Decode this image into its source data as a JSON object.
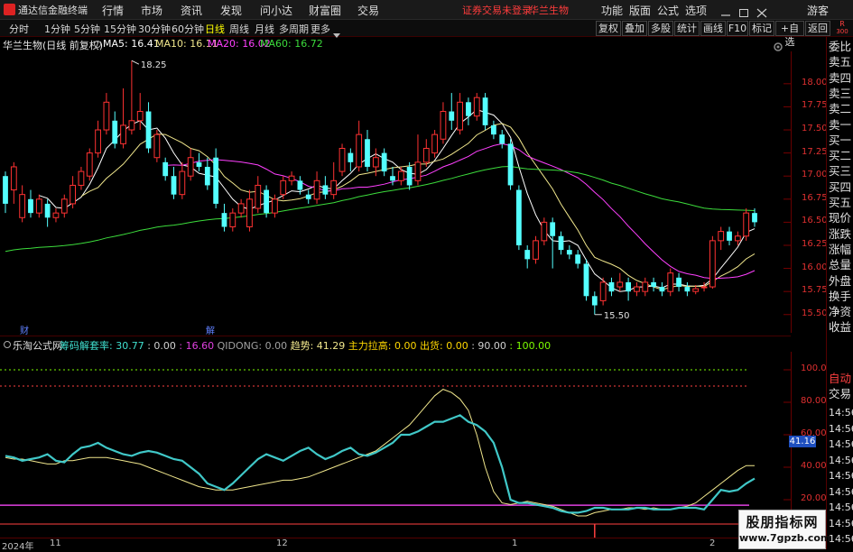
{
  "app": {
    "title": "通达信金融终端"
  },
  "menu": {
    "items": [
      "行情",
      "市场",
      "资讯",
      "发现",
      "问小达",
      "财富圈",
      "交易"
    ],
    "notice": "证券交易未登录",
    "stock": "华兰生物",
    "right_items": [
      "功能",
      "版面",
      "公式",
      "选项"
    ],
    "guest": "游客"
  },
  "toolbar": {
    "periods": [
      "分时",
      "1分钟",
      "5分钟",
      "15分钟",
      "30分钟",
      "60分钟",
      "日线",
      "周线",
      "月线",
      "多周期",
      "更多"
    ],
    "active_period": "日线",
    "buttons": [
      "复权",
      "叠加",
      "多股",
      "统计",
      "画线",
      "F10",
      "标记",
      "+自选",
      "返回"
    ],
    "corner_top": "R",
    "corner_code": "300"
  },
  "main": {
    "title": "华兰生物(日线 前复权)",
    "ma": [
      {
        "label": "MA5: 16.41",
        "color": "#ffffff"
      },
      {
        "label": "MA10: 16.11",
        "color": "#f0e68c"
      },
      {
        "label": "MA20: 16.02",
        "color": "#ff40ff"
      },
      {
        "label": "MA60: 16.72",
        "color": "#3cdc3c"
      }
    ],
    "high_label": "18.25",
    "low_label": "15.50",
    "price_ticks": [
      "18.00",
      "17.75",
      "17.50",
      "17.25",
      "17.00",
      "16.75",
      "16.50",
      "16.25",
      "16.00",
      "15.75",
      "15.50"
    ],
    "markers": [
      "财",
      "解"
    ]
  },
  "indicator": {
    "name": "乐淘公式网",
    "parts": [
      {
        "text": "筹码解套率: 30.77",
        "color": "#40e0d0"
      },
      {
        "text": ": 0.00",
        "color": "#d0d0d0"
      },
      {
        "text": ": 16.60",
        "color": "#e040e0"
      },
      {
        "text": "QIDONG: 0.00",
        "color": "#a0a0a0"
      },
      {
        "text": "趋势: 41.29",
        "color": "#f0e68c"
      },
      {
        "text": "主力拉高: 0.00",
        "color": "#ffd700"
      },
      {
        "text": "出货: 0.00",
        "color": "#ffd700"
      },
      {
        "text": ": 90.00",
        "color": "#d0d0d0"
      },
      {
        "text": ": 100.00",
        "color": "#7cfc00"
      }
    ],
    "ticks": [
      "100.00",
      "80.00",
      "60.00",
      "40.00",
      "20.00"
    ],
    "current_value": "41.16"
  },
  "date_axis": {
    "labels": [
      "2024年",
      "11",
      "12",
      "1",
      "2"
    ]
  },
  "right_panel": {
    "items": [
      "委比",
      "卖五",
      "卖四",
      "卖三",
      "卖二",
      "卖一",
      "买一",
      "买二",
      "买三",
      "买四",
      "买五",
      "现价",
      "涨跌",
      "涨幅",
      "总量",
      "外盘",
      "换手",
      "净资",
      "收益"
    ],
    "mode_items": [
      "自动",
      "交易"
    ],
    "times": [
      "14:56",
      "14:56",
      "14:56",
      "14:56",
      "14:56",
      "14:56",
      "14:56",
      "14:56",
      "14:56"
    ]
  },
  "watermark": {
    "line1": "股朋指标网",
    "line2": "www.7gpzb.com"
  },
  "chart_data": {
    "type": "candlestick",
    "y_range": [
      15.4,
      18.35
    ],
    "candles": [
      [
        17.0,
        16.7,
        17.05,
        16.6
      ],
      [
        16.85,
        17.1,
        17.15,
        16.7
      ],
      [
        16.55,
        16.8,
        16.9,
        16.5
      ],
      [
        16.75,
        16.6,
        16.85,
        16.55
      ],
      [
        16.6,
        16.75,
        16.8,
        16.55
      ],
      [
        16.7,
        16.55,
        16.75,
        16.45
      ],
      [
        16.55,
        16.6,
        16.65,
        16.5
      ],
      [
        16.6,
        16.75,
        16.8,
        16.55
      ],
      [
        16.7,
        16.9,
        17.0,
        16.65
      ],
      [
        16.9,
        17.05,
        17.1,
        16.85
      ],
      [
        17.0,
        17.25,
        17.3,
        16.95
      ],
      [
        17.25,
        17.5,
        17.6,
        17.2
      ],
      [
        17.5,
        17.8,
        17.9,
        17.45
      ],
      [
        17.6,
        17.35,
        17.7,
        17.3
      ],
      [
        17.35,
        17.55,
        17.95,
        17.3
      ],
      [
        17.5,
        17.6,
        18.25,
        17.45
      ],
      [
        17.6,
        17.7,
        17.9,
        17.5
      ],
      [
        17.7,
        17.3,
        17.8,
        17.25
      ],
      [
        17.2,
        17.45,
        17.5,
        17.15
      ],
      [
        17.15,
        17.0,
        17.2,
        16.95
      ],
      [
        17.0,
        16.8,
        17.1,
        16.75
      ],
      [
        16.8,
        17.05,
        17.15,
        16.75
      ],
      [
        17.0,
        17.2,
        17.3,
        16.95
      ],
      [
        17.15,
        17.1,
        17.25,
        17.05
      ],
      [
        17.1,
        16.9,
        17.2,
        16.85
      ],
      [
        17.2,
        16.7,
        17.3,
        16.65
      ],
      [
        16.6,
        16.45,
        16.7,
        16.4
      ],
      [
        16.45,
        16.6,
        16.65,
        16.4
      ],
      [
        16.6,
        16.7,
        16.75,
        16.55
      ],
      [
        16.45,
        16.75,
        16.85,
        16.4
      ],
      [
        16.65,
        16.9,
        17.0,
        16.6
      ],
      [
        16.85,
        16.6,
        16.9,
        16.55
      ],
      [
        16.6,
        16.75,
        16.8,
        16.55
      ],
      [
        16.8,
        16.95,
        17.0,
        16.75
      ],
      [
        16.95,
        17.0,
        17.05,
        16.9
      ],
      [
        16.95,
        16.85,
        17.0,
        16.8
      ],
      [
        16.8,
        16.75,
        16.85,
        16.7
      ],
      [
        16.75,
        16.95,
        17.05,
        16.7
      ],
      [
        16.9,
        16.8,
        17.0,
        16.75
      ],
      [
        16.8,
        16.95,
        17.15,
        16.75
      ],
      [
        17.05,
        17.3,
        17.35,
        17.0
      ],
      [
        17.25,
        17.15,
        17.3,
        17.05
      ],
      [
        17.1,
        17.45,
        17.6,
        17.05
      ],
      [
        17.4,
        17.1,
        17.5,
        17.05
      ],
      [
        17.1,
        17.2,
        17.3,
        17.0
      ],
      [
        17.25,
        17.05,
        17.3,
        17.0
      ],
      [
        17.0,
        16.95,
        17.1,
        16.9
      ],
      [
        16.95,
        17.05,
        17.1,
        16.9
      ],
      [
        17.1,
        16.9,
        17.15,
        16.85
      ],
      [
        16.95,
        17.15,
        17.45,
        16.9
      ],
      [
        17.15,
        17.3,
        17.4,
        17.1
      ],
      [
        17.25,
        17.45,
        17.5,
        17.2
      ],
      [
        17.4,
        17.7,
        17.8,
        17.35
      ],
      [
        17.7,
        17.6,
        17.9,
        17.5
      ],
      [
        17.5,
        17.8,
        17.9,
        17.45
      ],
      [
        17.8,
        17.65,
        17.85,
        17.55
      ],
      [
        17.65,
        17.85,
        17.9,
        17.6
      ],
      [
        17.85,
        17.55,
        17.9,
        17.5
      ],
      [
        17.55,
        17.45,
        17.6,
        17.4
      ],
      [
        17.45,
        17.35,
        17.5,
        17.3
      ],
      [
        17.35,
        16.9,
        17.4,
        16.85
      ],
      [
        16.85,
        16.25,
        16.9,
        16.2
      ],
      [
        16.2,
        16.1,
        16.25,
        16.0
      ],
      [
        16.1,
        16.3,
        16.35,
        16.05
      ],
      [
        16.3,
        16.5,
        16.55,
        16.25
      ],
      [
        16.5,
        16.35,
        16.55,
        16.0
      ],
      [
        16.35,
        16.2,
        16.4,
        16.15
      ],
      [
        16.2,
        16.15,
        16.25,
        16.1
      ],
      [
        16.15,
        16.05,
        16.2,
        16.0
      ],
      [
        16.05,
        15.7,
        16.1,
        15.65
      ],
      [
        15.7,
        15.6,
        15.75,
        15.5
      ],
      [
        15.65,
        15.85,
        15.9,
        15.6
      ],
      [
        15.85,
        15.75,
        15.9,
        15.7
      ],
      [
        15.8,
        15.85,
        15.95,
        15.75
      ],
      [
        15.85,
        15.75,
        15.9,
        15.65
      ],
      [
        15.75,
        15.8,
        15.85,
        15.7
      ],
      [
        15.75,
        15.85,
        15.9,
        15.7
      ],
      [
        15.85,
        15.8,
        15.9,
        15.75
      ],
      [
        15.8,
        15.75,
        15.85,
        15.7
      ],
      [
        15.75,
        15.95,
        16.0,
        15.7
      ],
      [
        15.9,
        15.8,
        15.95,
        15.75
      ],
      [
        15.8,
        15.75,
        15.85,
        15.7
      ],
      [
        15.75,
        15.78,
        15.82,
        15.72
      ],
      [
        15.8,
        15.8,
        15.85,
        15.75
      ],
      [
        15.8,
        16.3,
        16.35,
        15.78
      ],
      [
        16.3,
        16.4,
        16.45,
        16.2
      ],
      [
        16.4,
        16.3,
        16.45,
        16.25
      ],
      [
        16.3,
        16.35,
        16.4,
        16.25
      ],
      [
        16.35,
        16.6,
        16.65,
        16.3
      ],
      [
        16.6,
        16.5,
        16.65,
        16.45
      ]
    ],
    "indicator": {
      "y_range": [
        0,
        110
      ],
      "cyan": [
        47,
        46,
        44,
        45,
        46,
        48,
        44,
        43,
        48,
        52,
        53,
        55,
        52,
        50,
        48,
        47,
        49,
        50,
        49,
        47,
        45,
        44,
        40,
        36,
        30,
        28,
        26,
        30,
        35,
        40,
        45,
        48,
        46,
        44,
        47,
        50,
        52,
        48,
        45,
        47,
        50,
        52,
        48,
        47,
        49,
        52,
        55,
        60,
        60,
        62,
        65,
        68,
        68,
        70,
        72,
        68,
        66,
        62,
        55,
        40,
        20,
        18,
        18,
        17,
        16,
        15,
        13,
        12,
        12,
        13,
        15,
        15,
        14,
        14,
        14,
        15,
        15,
        14,
        14,
        14,
        15,
        15,
        15,
        14,
        20,
        26,
        25,
        26,
        30,
        33
      ],
      "yellow": [
        46,
        45,
        45,
        44,
        43,
        42,
        42,
        44,
        44,
        45,
        46,
        46,
        46,
        45,
        44,
        43,
        42,
        40,
        38,
        36,
        34,
        32,
        30,
        28,
        27,
        26,
        26,
        26,
        27,
        28,
        29,
        30,
        31,
        32,
        32,
        33,
        34,
        36,
        38,
        40,
        42,
        44,
        46,
        48,
        50,
        54,
        58,
        62,
        66,
        72,
        78,
        84,
        88,
        86,
        82,
        75,
        60,
        40,
        25,
        18,
        17,
        18,
        19,
        18,
        17,
        16,
        14,
        12,
        10,
        10,
        12,
        13,
        14,
        14,
        15,
        15,
        14,
        15,
        14,
        14,
        15,
        16,
        18,
        22,
        26,
        30,
        34,
        38,
        41,
        41
      ],
      "pink": [
        16.6
      ],
      "red": [
        5
      ]
    }
  }
}
